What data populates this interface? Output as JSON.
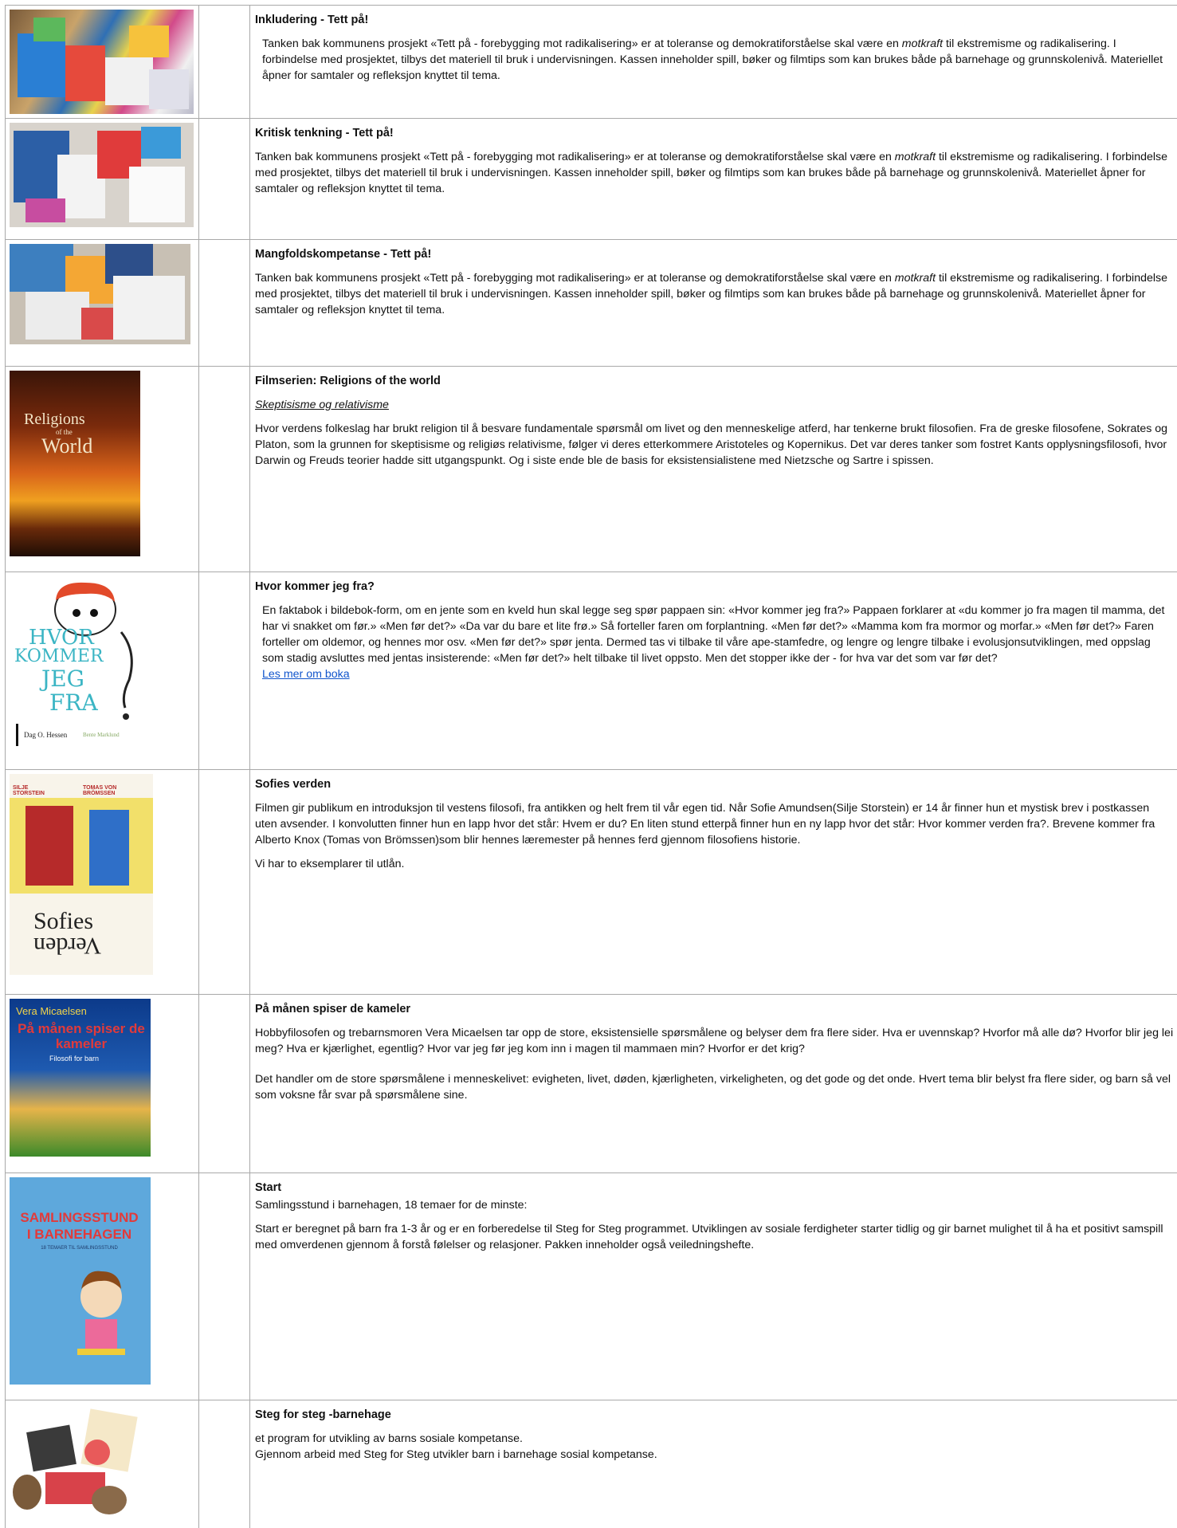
{
  "rows": [
    {
      "title": "Inkludering - Tett på!",
      "para1_pre": "Tanken bak kommunens prosjekt «Tett på - forebygging mot radikalisering» er at toleranse og demokratiforståelse skal være en ",
      "para1_em": "motkraft",
      "para1_post": " til ekstremisme og radikalisering. I forbindelse med prosjektet, tilbys det materiell til bruk i undervisningen. Kassen inneholder spill, bøker og filmtips som kan brukes både på barnehage og grunnskolenivå. Materiellet åpner for samtaler og refleksjon knyttet til tema."
    },
    {
      "title": "Kritisk tenkning - Tett på!",
      "para1_pre": "Tanken bak kommunens prosjekt «Tett på - forebygging mot radikalisering» er at toleranse og demokratiforståelse skal være en ",
      "para1_em": "motkraft",
      "para1_post": " til ekstremisme og radikalisering. I forbindelse med prosjektet, tilbys det materiell til bruk i undervisningen. Kassen inneholder spill, bøker og filmtips som kan brukes både på barnehage og grunnskolenivå. Materiellet åpner for samtaler og refleksjon knyttet til tema."
    },
    {
      "title": "Mangfoldskompetanse - Tett på!",
      "para1_pre": "Tanken bak kommunens prosjekt «Tett på - forebygging mot radikalisering» er at toleranse og demokratiforståelse skal være en ",
      "para1_em": "motkraft",
      "para1_post": " til ekstremisme og radikalisering. I forbindelse med prosjektet, tilbys det materiell til bruk i undervisningen. Kassen inneholder spill, bøker og filmtips som kan brukes både på barnehage og grunnskolenivå. Materiellet åpner for samtaler og refleksjon knyttet til tema."
    },
    {
      "title": "Filmserien: Religions of the world",
      "subtitle": "Skeptisisme og relativisme",
      "para1": "Hvor verdens folkeslag har brukt religion til å besvare fundamentale spørsmål om livet og den menneskelige atferd, har tenkerne brukt filosofien. Fra de greske filosofene, Sokrates og Platon, som la grunnen for skeptisisme og religiøs relativisme, følger vi deres etterkommere Aristoteles og Kopernikus. Det var deres tanker som fostret Kants opplysningsfilosofi, hvor Darwin og Freuds teorier hadde sitt utgangspunkt. Og i siste ende ble de basis for eksistensialistene med Nietzsche og Sartre i spissen.",
      "cover_title": "Religions",
      "cover_sub": "of the",
      "cover_title2": "World"
    },
    {
      "title": "Hvor kommer jeg fra?",
      "para1": "En faktabok i bildebok-form, om en jente som en kveld hun skal legge seg spør pappaen sin: «Hvor kommer jeg fra?» Pappaen forklarer at «du kommer jo fra magen til mamma, det har vi snakket om før.» «Men før det?» «Da var du bare et lite frø.» Så forteller faren om forplantning. «Men før det?» «Mamma kom fra mormor og morfar.» «Men før det?» Faren forteller om oldemor, og hennes mor osv. «Men før det?» spør jenta. Dermed tas vi tilbake til våre ape-stamfedre, og lengre og lengre tilbake i evolusjonsutviklingen, med oppslag som stadig avsluttes med jentas insisterende: «Men før det?» helt tilbake til livet oppsto. Men det stopper ikke der - for hva var det som var før det?",
      "link": "Les mer om boka",
      "cover_words": [
        "HVOR",
        "KOMMER",
        "JEG",
        "FRA"
      ],
      "cover_author": "Dag O. Hessen",
      "cover_illustrator": "Bente Marklund"
    },
    {
      "title": "Sofies verden",
      "para1": "Filmen gir publikum en introduksjon til vestens filosofi, fra antikken og helt frem til vår egen tid. Når Sofie Amundsen(Silje Storstein) er 14 år finner hun et mystisk brev i postkassen uten avsender. I konvolutten finner hun en lapp hvor det står: Hvem er du? En liten stund etterpå finner hun en ny lapp hvor det står: Hvor kommer verden fra?. Brevene kommer fra Alberto Knox (Tomas von Brömssen)som blir hennes læremester på hennes ferd gjennom filosofiens historie.",
      "para2": "Vi har to eksemplarer til utlån.",
      "cover_actor1": "SILJE STORSTEIN",
      "cover_actor2": "TOMAS VON BRÖMSSEN",
      "cover_word1": "Sofies",
      "cover_word2": "Verden"
    },
    {
      "title": "På månen spiser de kameler",
      "para1": "Hobbyfilosofen og trebarnsmoren Vera Micaelsen tar opp de store, eksistensielle spørsmålene og belyser dem fra flere sider. Hva er uvennskap? Hvorfor må alle dø? Hvorfor blir jeg lei meg? Hva er kjærlighet, egentlig? Hvor var jeg før jeg kom inn i magen til mammaen min? Hvorfor er det krig?",
      "para2": "Det handler om de store spørsmålene i menneskelivet: evigheten, livet, døden, kjærligheten, virkeligheten, og det gode og det onde. Hvert tema blir belyst fra flere sider, og barn så vel som voksne får svar på spørsmålene sine.",
      "cover_author": "Vera Micaelsen",
      "cover_title": "På månen spiser de kameler",
      "cover_sub": "Filosofi for barn"
    },
    {
      "title": "Start",
      "subline": " Samlingsstund i barnehagen, 18 temaer for de minste:",
      "para1": "Start er beregnet på barn fra 1-3 år og er en forberedelse til Steg for Steg programmet. Utviklingen av sosiale ferdigheter starter tidlig og gir barnet mulighet til å ha et positivt samspill med omverdenen gjennom å forstå følelser og relasjoner. Pakken inneholder også veiledningshefte.",
      "cover_title": "SAMLINGSSTUND I BARNEHAGEN",
      "cover_sub": "18 TEMAER TIL SAMLINGSSTUND"
    },
    {
      "title": "Steg for steg -barnehage",
      "para1": "et program for utvikling av barns sosiale kompetanse.",
      "para2": " Gjennom arbeid med Steg for Steg utvikler barn i barnehage sosial kompetanse."
    }
  ]
}
